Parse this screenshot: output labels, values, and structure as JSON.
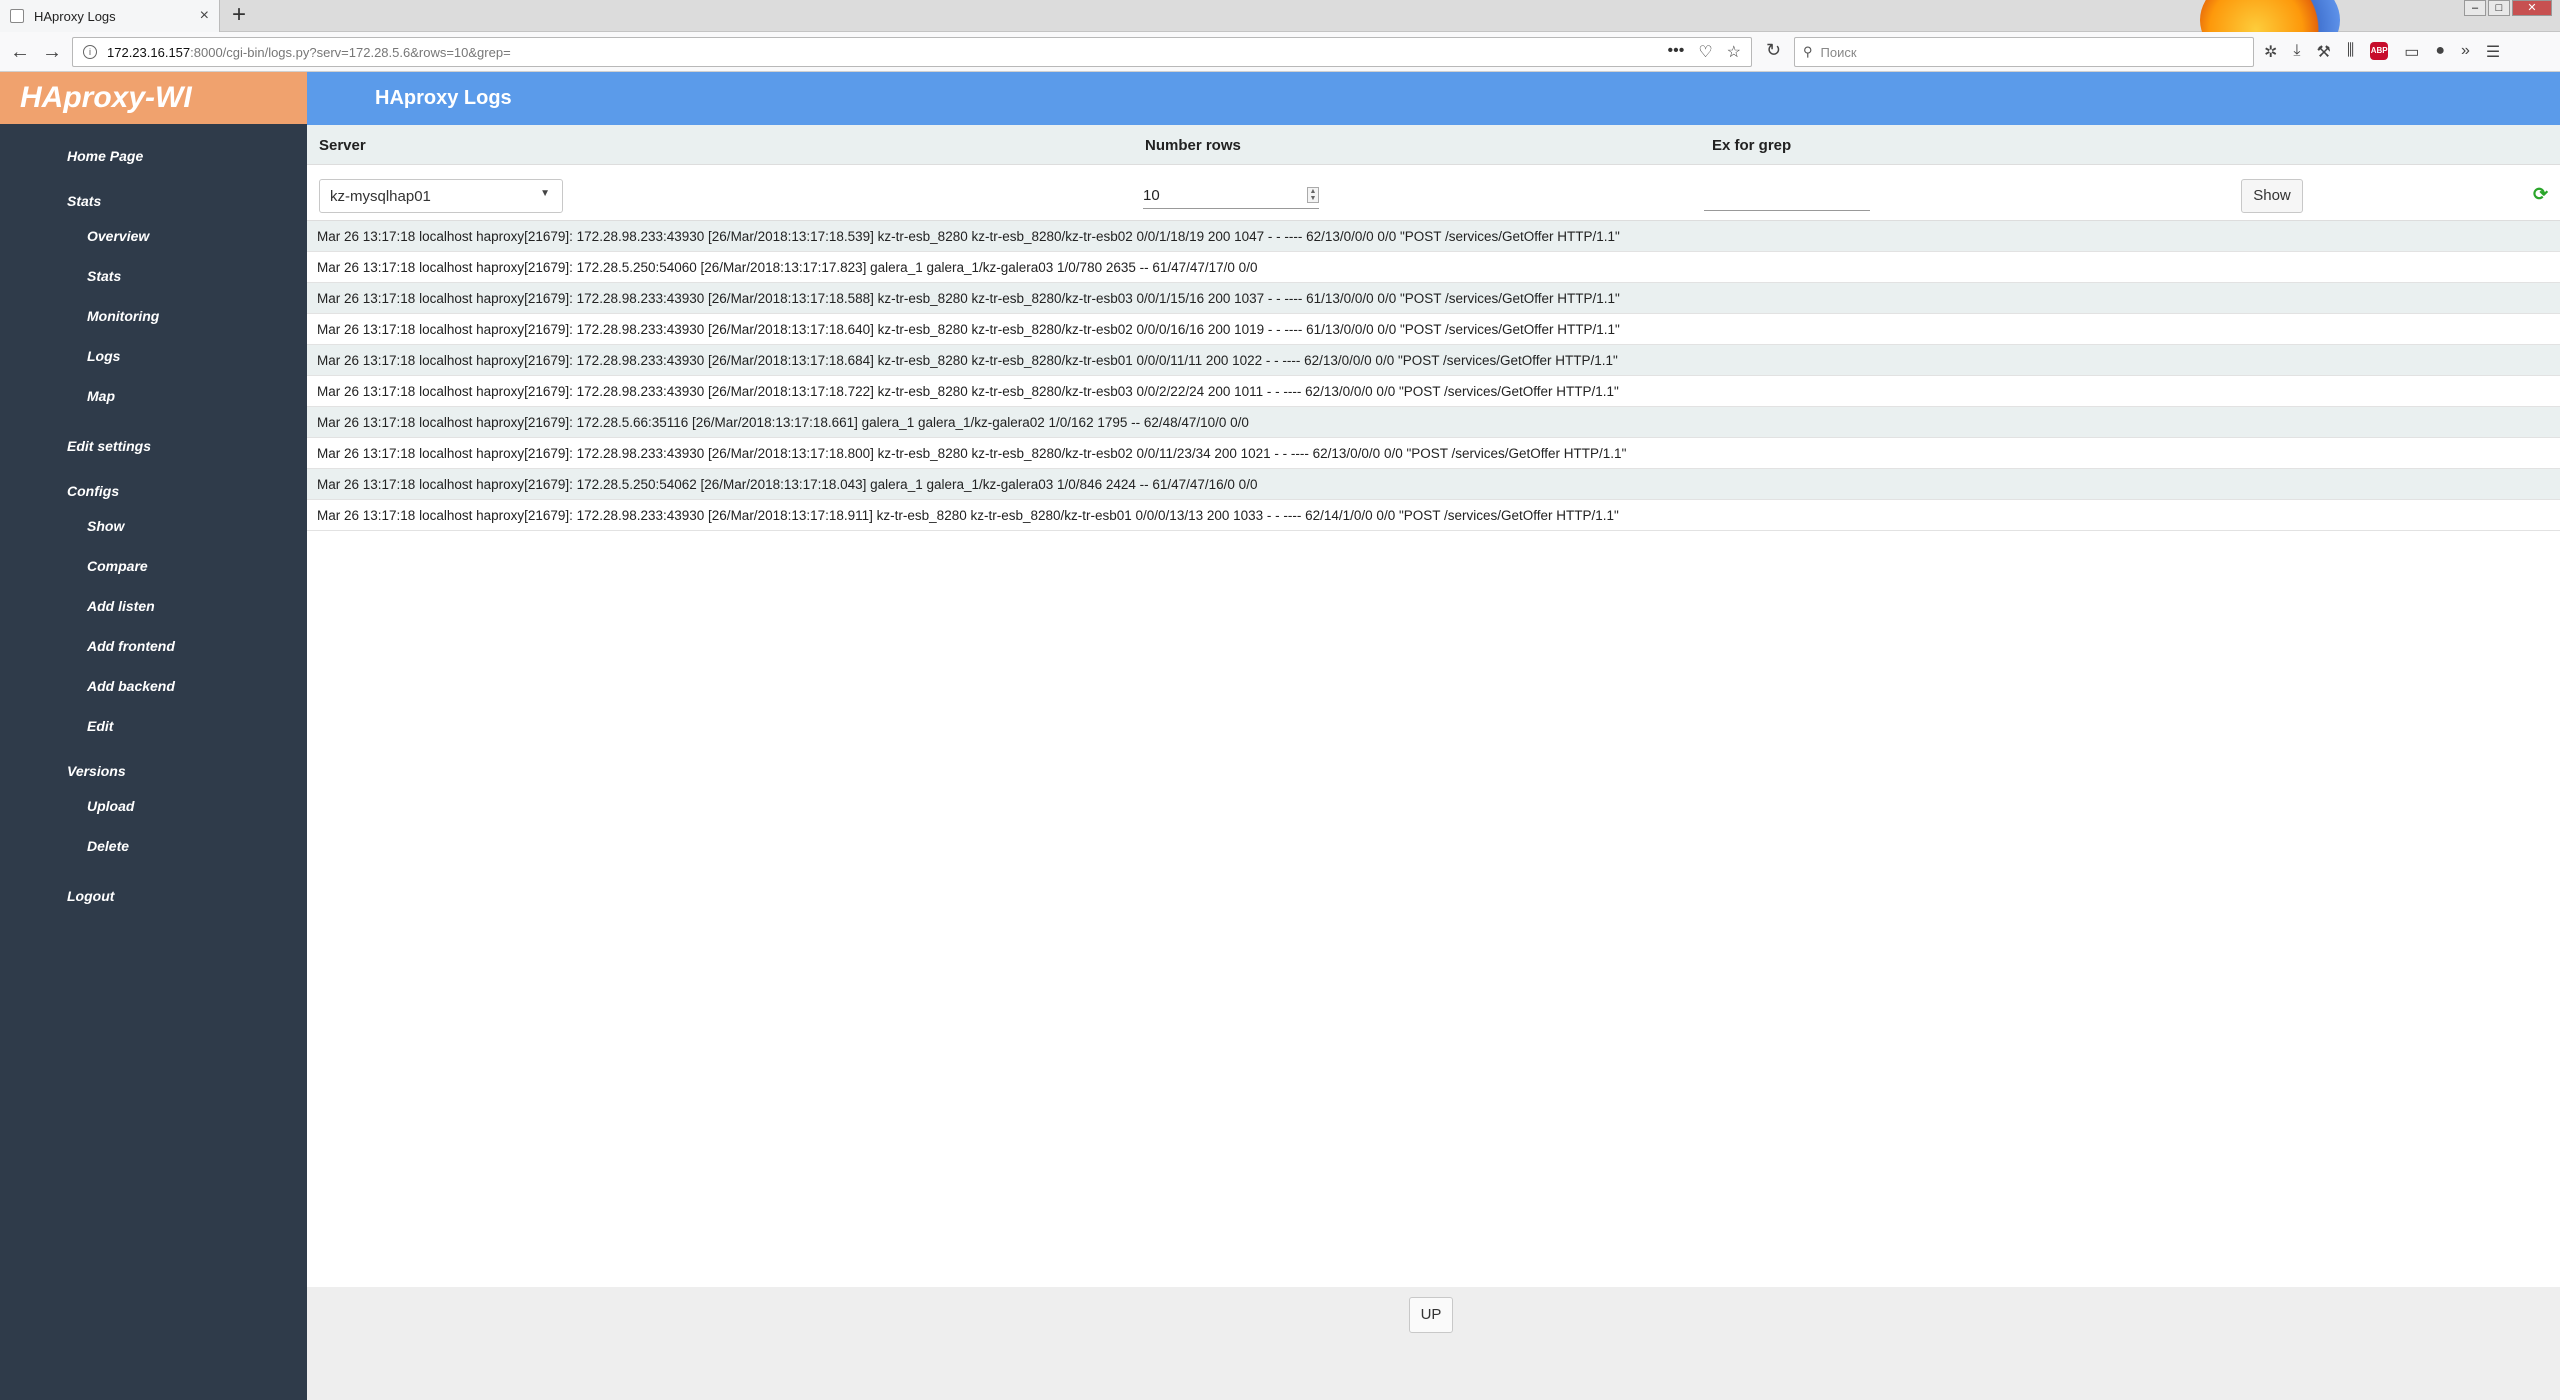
{
  "browser": {
    "tab_title": "HAproxy Logs",
    "tab_close": "×",
    "new_tab": "+",
    "url_host": "172.23.16.157",
    "url_path": ":8000/cgi-bin/logs.py?serv=172.28.5.6&rows=10&grep=",
    "search_placeholder": "Поиск",
    "page_actions": "•••"
  },
  "app": {
    "logo": "HAproxy-WI",
    "page_title": "HAproxy Logs"
  },
  "sidebar": {
    "home": "Home Page",
    "stats_head": "Stats",
    "stats_items": [
      "Overview",
      "Stats",
      "Monitoring",
      "Logs",
      "Map"
    ],
    "edit_settings": "Edit settings",
    "configs_head": "Configs",
    "configs_items": [
      "Show",
      "Compare",
      "Add listen",
      "Add frontend",
      "Add backend",
      "Edit"
    ],
    "versions_head": "Versions",
    "versions_items": [
      "Upload",
      "Delete"
    ],
    "logout": "Logout"
  },
  "form": {
    "server_label": "Server",
    "rows_label": "Number rows",
    "grep_label": "Ex for grep",
    "server_value": "kz-mysqlhap01",
    "rows_value": "10",
    "grep_value": "",
    "show_button": "Show"
  },
  "logs": [
    "Mar 26 13:17:18 localhost haproxy[21679]: 172.28.98.233:43930 [26/Mar/2018:13:17:18.539] kz-tr-esb_8280 kz-tr-esb_8280/kz-tr-esb02 0/0/1/18/19 200 1047 - - ---- 62/13/0/0/0 0/0 \"POST /services/GetOffer HTTP/1.1\"",
    "Mar 26 13:17:18 localhost haproxy[21679]: 172.28.5.250:54060 [26/Mar/2018:13:17:17.823] galera_1 galera_1/kz-galera03 1/0/780 2635 -- 61/47/47/17/0 0/0",
    "Mar 26 13:17:18 localhost haproxy[21679]: 172.28.98.233:43930 [26/Mar/2018:13:17:18.588] kz-tr-esb_8280 kz-tr-esb_8280/kz-tr-esb03 0/0/1/15/16 200 1037 - - ---- 61/13/0/0/0 0/0 \"POST /services/GetOffer HTTP/1.1\"",
    "Mar 26 13:17:18 localhost haproxy[21679]: 172.28.98.233:43930 [26/Mar/2018:13:17:18.640] kz-tr-esb_8280 kz-tr-esb_8280/kz-tr-esb02 0/0/0/16/16 200 1019 - - ---- 61/13/0/0/0 0/0 \"POST /services/GetOffer HTTP/1.1\"",
    "Mar 26 13:17:18 localhost haproxy[21679]: 172.28.98.233:43930 [26/Mar/2018:13:17:18.684] kz-tr-esb_8280 kz-tr-esb_8280/kz-tr-esb01 0/0/0/11/11 200 1022 - - ---- 62/13/0/0/0 0/0 \"POST /services/GetOffer HTTP/1.1\"",
    "Mar 26 13:17:18 localhost haproxy[21679]: 172.28.98.233:43930 [26/Mar/2018:13:17:18.722] kz-tr-esb_8280 kz-tr-esb_8280/kz-tr-esb03 0/0/2/22/24 200 1011 - - ---- 62/13/0/0/0 0/0 \"POST /services/GetOffer HTTP/1.1\"",
    "Mar 26 13:17:18 localhost haproxy[21679]: 172.28.5.66:35116 [26/Mar/2018:13:17:18.661] galera_1 galera_1/kz-galera02 1/0/162 1795 -- 62/48/47/10/0 0/0",
    "Mar 26 13:17:18 localhost haproxy[21679]: 172.28.98.233:43930 [26/Mar/2018:13:17:18.800] kz-tr-esb_8280 kz-tr-esb_8280/kz-tr-esb02 0/0/11/23/34 200 1021 - - ---- 62/13/0/0/0 0/0 \"POST /services/GetOffer HTTP/1.1\"",
    "Mar 26 13:17:18 localhost haproxy[21679]: 172.28.5.250:54062 [26/Mar/2018:13:17:18.043] galera_1 galera_1/kz-galera03 1/0/846 2424 -- 61/47/47/16/0 0/0",
    "Mar 26 13:17:18 localhost haproxy[21679]: 172.28.98.233:43930 [26/Mar/2018:13:17:18.911] kz-tr-esb_8280 kz-tr-esb_8280/kz-tr-esb01 0/0/0/13/13 200 1033 - - ---- 62/14/1/0/0 0/0 \"POST /services/GetOffer HTTP/1.1\""
  ],
  "footer": {
    "up_button": "UP"
  },
  "colors": {
    "sidebar": "#2f3b4a",
    "logo_bg": "#f0a26e",
    "header": "#5b9bea",
    "row_alt": "#eaf0f0"
  }
}
